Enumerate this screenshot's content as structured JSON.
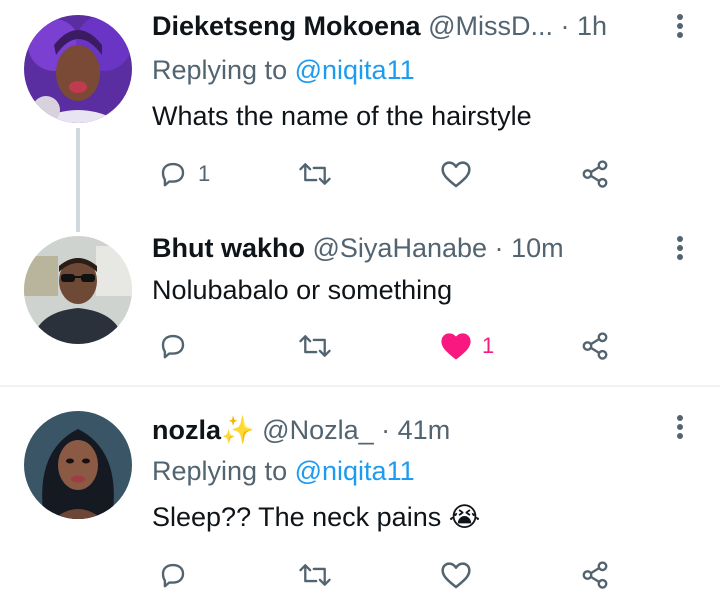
{
  "tweets": [
    {
      "name": "Dieketseng Mokoena",
      "handle": "@MissD...",
      "time": "1h",
      "replying_prefix": "Replying to",
      "replying_to": "@niqita11",
      "text": "Whats the name of the hairstyle",
      "reply_count": "1",
      "retweet_count": "",
      "like_count": "",
      "liked": false
    },
    {
      "name": "Bhut wakho",
      "handle": "@SiyaHanabe",
      "time": "10m",
      "text": "Nolubabalo or something",
      "reply_count": "",
      "retweet_count": "",
      "like_count": "1",
      "liked": true
    },
    {
      "name": "nozla",
      "name_emoji": "✨",
      "handle": "@Nozla_",
      "time": "41m",
      "replying_prefix": "Replying to",
      "replying_to": "@niqita11",
      "text": "Sleep?? The neck pains",
      "text_emoji": "😭",
      "reply_count": "",
      "retweet_count": "",
      "like_count": "",
      "liked": false
    }
  ],
  "separator": "·",
  "colors": {
    "name": "#0f1419",
    "secondary": "#536471",
    "mention": "#1d9bf0",
    "like_active": "#f91880",
    "thread_line": "#cfd9de",
    "divider": "#eff3f4"
  },
  "icons": [
    "reply-icon",
    "retweet-icon",
    "like-icon",
    "share-icon",
    "more-icon"
  ]
}
